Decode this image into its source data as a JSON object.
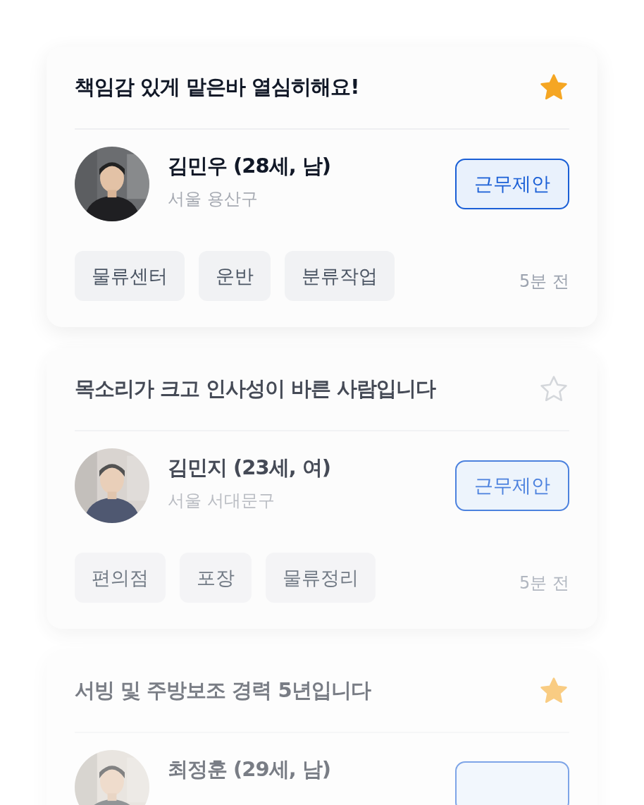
{
  "cards": [
    {
      "title": "책임감 있게 맡은바 열심히해요!",
      "starred": true,
      "name": "김민우 (28세, 남)",
      "location": "서울 용산구",
      "button": "근무제안",
      "tags": [
        "물류센터",
        "운반",
        "분류작업"
      ],
      "time": "5분 전"
    },
    {
      "title": "목소리가 크고 인사성이 바른 사람입니다",
      "starred": false,
      "name": "김민지 (23세, 여)",
      "location": "서울 서대문구",
      "button": "근무제안",
      "tags": [
        "편의점",
        "포장",
        "물류정리"
      ],
      "time": "5분 전"
    },
    {
      "title": "서빙 및 주방보조 경력 5년입니다",
      "starred": true,
      "name": "최정훈 (29세, 남)"
    }
  ]
}
